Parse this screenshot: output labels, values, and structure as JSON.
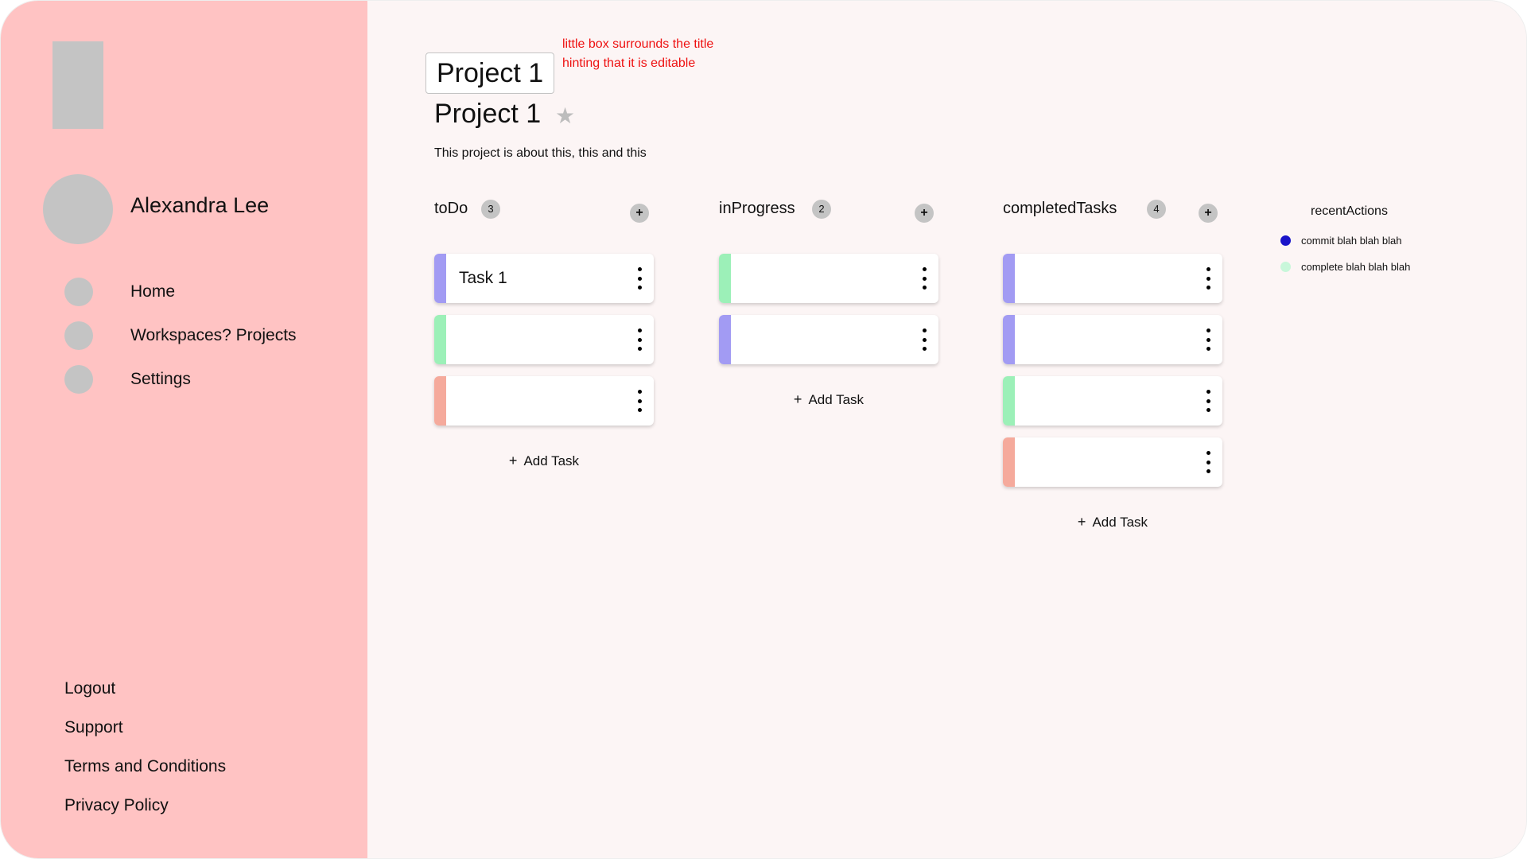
{
  "sidebar": {
    "user_name": "Alexandra Lee",
    "nav": [
      {
        "label": "Home"
      },
      {
        "label": "Workspaces? Projects"
      },
      {
        "label": "Settings"
      }
    ],
    "footer": [
      {
        "label": "Logout"
      },
      {
        "label": "Support"
      },
      {
        "label": "Terms and Conditions"
      },
      {
        "label": "Privacy Policy"
      }
    ]
  },
  "header": {
    "editable_title": "Project 1",
    "annotation_line1": "little box surrounds the title",
    "annotation_line2": "hinting that it is editable",
    "title": "Project 1",
    "star_icon": "★",
    "description": "This project is about this, this and this"
  },
  "columns": [
    {
      "title": "toDo",
      "count": "3",
      "add_icon": "+",
      "tasks": [
        {
          "title": "Task 1",
          "accent": "#a29bf3"
        },
        {
          "title": "",
          "accent": "#9cf0b8"
        },
        {
          "title": "",
          "accent": "#f5aa9c"
        }
      ],
      "add_task_label": "Add Task"
    },
    {
      "title": "inProgress",
      "count": "2",
      "add_icon": "+",
      "tasks": [
        {
          "title": "",
          "accent": "#9cf0b8"
        },
        {
          "title": "",
          "accent": "#a29bf3"
        }
      ],
      "add_task_label": "Add Task"
    },
    {
      "title": "completedTasks",
      "count": "4",
      "add_icon": "+",
      "tasks": [
        {
          "title": "",
          "accent": "#a29bf3"
        },
        {
          "title": "",
          "accent": "#a29bf3"
        },
        {
          "title": "",
          "accent": "#9cf0b8"
        },
        {
          "title": "",
          "accent": "#f5aa9c"
        }
      ],
      "add_task_label": "Add Task"
    }
  ],
  "recent_actions": {
    "title": "recentActions",
    "items": [
      {
        "text": "commit blah blah blah",
        "color": "#1a14c9"
      },
      {
        "text": "complete blah blah blah",
        "color": "#c8f7da"
      }
    ]
  },
  "colors": {
    "sidebar_bg": "#ffc3c3",
    "main_bg": "#fcf5f5",
    "placeholder_gray": "#c4c4c4",
    "annotation_red": "#ee1111"
  }
}
